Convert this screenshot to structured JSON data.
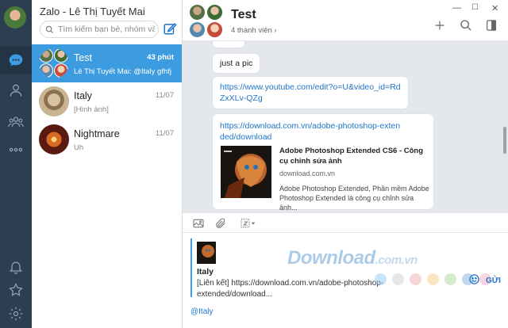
{
  "app": {
    "title": "Zalo - Lê Thị Tuyết Mai"
  },
  "search": {
    "placeholder": "Tìm kiếm bạn bè, nhóm và tin"
  },
  "conversations": [
    {
      "name": "Test",
      "time": "43 phút",
      "snippet": "Lê Thị Tuyết Mai: @Italy gfhfj",
      "active": true
    },
    {
      "name": "Italy",
      "time": "11/07",
      "snippet": "[Hình ảnh]",
      "active": false
    },
    {
      "name": "Nightmare",
      "time": "11/07",
      "snippet": "Uh",
      "active": false
    }
  ],
  "chat": {
    "title": "Test",
    "members": "4 thành viên",
    "messages": [
      {
        "text": "just a pic"
      },
      {
        "link": "https://www.youtube.com/edit?o=U&video_id=RdZxXLv-QZg"
      }
    ],
    "preview": {
      "link": "https://download.com.vn/adobe-photoshop-extended/download",
      "title": "Adobe Photoshop Extended CS6 - Công cụ chỉnh sửa ảnh",
      "domain": "download.com.vn",
      "description": "Adobe Photoshop Extended, Phần mềm Adobe Photoshop Extended là công cụ chỉnh sửa ảnh..."
    }
  },
  "composer": {
    "reply": {
      "name": "Italy",
      "text": "[Liên kết] https://download.com.vn/adobe-photoshop-extended/download..."
    },
    "input_value": "@Italy",
    "send_label": "GỬI"
  },
  "watermark": {
    "main": "Download",
    "suffix": ".com.vn"
  },
  "colors": {
    "accent": "#3d9be0",
    "rail": "#2c3e50",
    "link": "#1e74c9",
    "chat_bg": "#e4e8ec"
  },
  "icons": {
    "rail": [
      "chat-icon",
      "contact-icon",
      "group-icon",
      "more-icon",
      "bell-icon",
      "star-icon",
      "settings-icon"
    ],
    "header": [
      "add-icon",
      "search-icon",
      "panel-icon"
    ],
    "toolbar": [
      "image-icon",
      "attach-icon",
      "screenshot-icon"
    ]
  }
}
